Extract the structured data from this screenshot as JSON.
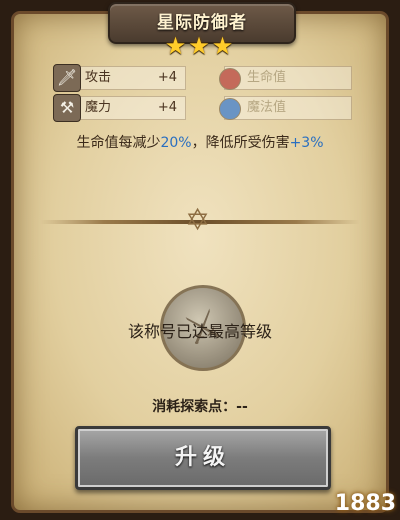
{
  "title": "星际防御者",
  "stars": "★★★",
  "stats": {
    "attack": {
      "label": "攻击",
      "value": "+4",
      "icon": "sword-icon"
    },
    "magic": {
      "label": "魔力",
      "value": "+4",
      "icon": "staff-icon"
    },
    "hp": {
      "label": "生命值",
      "icon": "red-orb-icon"
    },
    "mp": {
      "label": "魔法值",
      "icon": "blue-orb-icon"
    }
  },
  "description": {
    "part1": "生命值每减少",
    "pct1": "20%",
    "part2": "，降低所受伤害",
    "pct2": "+3%"
  },
  "status": "该称号已达最高等级",
  "cost": "消耗探索点：--",
  "upgrade_label": "升级",
  "watermark": "1883",
  "colors": {
    "highlight": "#2a6fc0",
    "star": "#ffcc2a"
  }
}
